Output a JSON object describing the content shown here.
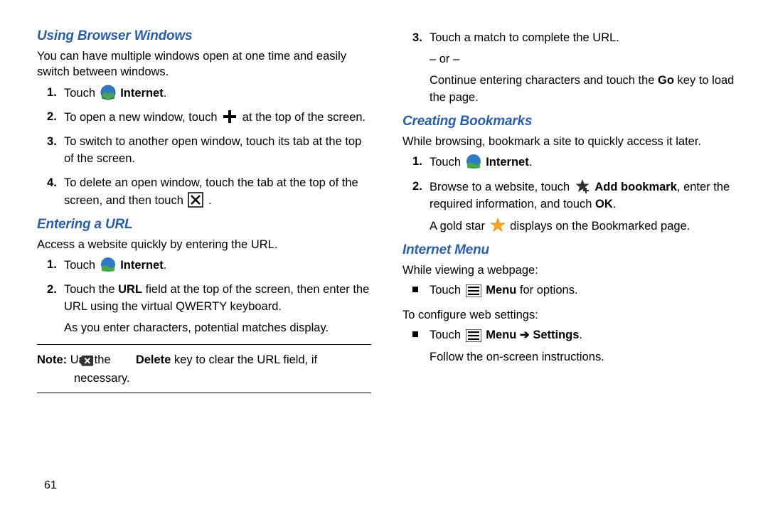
{
  "pageNumber": "61",
  "left": {
    "section1": {
      "heading": "Using Browser Windows",
      "intro": "You can have multiple windows open at one time and easily switch between windows.",
      "steps": {
        "s1_touch": "Touch",
        "s1_internet": "Internet",
        "s1_period": ".",
        "s2_pre": "To open a new window, touch",
        "s2_post": "at the top of the screen.",
        "s3": "To switch to another open window, touch its tab at the top of the screen.",
        "s4_pre": "To delete an open window, touch the tab at the top of the screen, and then touch",
        "s4_post": "."
      }
    },
    "section2": {
      "heading": "Entering a URL",
      "intro": "Access a website quickly by entering the URL.",
      "steps": {
        "s1_touch": "Touch",
        "s1_internet": "Internet",
        "s1_period": ".",
        "s2_a": "Touch the ",
        "s2_url": "URL",
        "s2_b": " field at the top of the screen, then enter the URL using the virtual QWERTY keyboard.",
        "s2_follow": "As you enter characters, potential matches display."
      },
      "note": {
        "label": "Note:",
        "pre": " Use the ",
        "delete": "Delete",
        "post": " key to clear the URL field, if necessary."
      }
    }
  },
  "right": {
    "topSteps": {
      "s3_top": "Touch a match to complete the URL.",
      "s3_or": "– or –",
      "s3_a": "Continue entering characters and touch the ",
      "s3_go": "Go",
      "s3_b": " key to load the page."
    },
    "section3": {
      "heading": "Creating Bookmarks",
      "intro": "While browsing, bookmark a site to quickly access it later.",
      "steps": {
        "s1_touch": "Touch",
        "s1_internet": "Internet",
        "s1_period": ".",
        "s2_a": "Browse to a website, touch ",
        "s2_add": "Add bookmark",
        "s2_b": ", enter the required information, and touch ",
        "s2_ok": "OK",
        "s2_c": ".",
        "s2_follow_a": "A gold star ",
        "s2_follow_b": " displays on the Bookmarked page."
      }
    },
    "section4": {
      "heading": "Internet Menu",
      "intro1": "While viewing a webpage:",
      "bullet1_a": "Touch ",
      "bullet1_menu": "Menu",
      "bullet1_b": " for options.",
      "intro2": "To configure web settings:",
      "bullet2_a": "Touch ",
      "bullet2_menu": "Menu",
      "bullet2_arrow": " ➔ ",
      "bullet2_settings": "Settings",
      "bullet2_c": ".",
      "bullet2_follow": "Follow the on-screen instructions."
    }
  }
}
